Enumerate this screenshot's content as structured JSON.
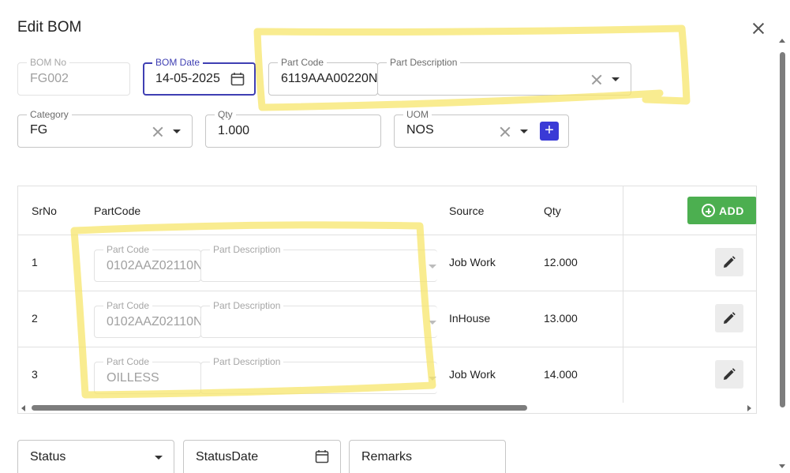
{
  "dialog": {
    "title": "Edit BOM"
  },
  "header_fields": {
    "bom_no": {
      "label": "BOM No",
      "value": "FG002"
    },
    "bom_date": {
      "label": "BOM Date",
      "value": "14-05-2025"
    },
    "part_code": {
      "label": "Part Code",
      "value": "6119AAA00220N"
    },
    "part_description": {
      "label": "Part Description",
      "value": ""
    },
    "category": {
      "label": "Category",
      "value": "FG"
    },
    "qty": {
      "label": "Qty",
      "value": "1.000"
    },
    "uom": {
      "label": "UOM",
      "value": "NOS"
    }
  },
  "table": {
    "columns": {
      "srno": "SrNo",
      "partcode": "PartCode",
      "source": "Source",
      "qty": "Qty"
    },
    "add_label": "ADD",
    "rows": [
      {
        "srno": "1",
        "part_code_label": "Part Code",
        "part_code": "0102AAZ02110N",
        "desc_label": "Part Description",
        "description": "",
        "source": "Job Work",
        "qty": "12.000"
      },
      {
        "srno": "2",
        "part_code_label": "Part Code",
        "part_code": "0102AAZ02110N",
        "desc_label": "Part Description",
        "description": "",
        "source": "InHouse",
        "qty": "13.000"
      },
      {
        "srno": "3",
        "part_code_label": "Part Code",
        "part_code": "OILLESS",
        "desc_label": "Part Description",
        "description": "",
        "source": "Job Work",
        "qty": "14.000"
      }
    ]
  },
  "footer_fields": {
    "status": {
      "placeholder": "Status"
    },
    "status_date": {
      "placeholder": "StatusDate"
    },
    "remarks": {
      "placeholder": "Remarks"
    }
  },
  "colors": {
    "focus": "#3f3fb3",
    "add_button": "#4caf50",
    "plus_button": "#3a3ad6",
    "highlight": "#f7e56b"
  }
}
